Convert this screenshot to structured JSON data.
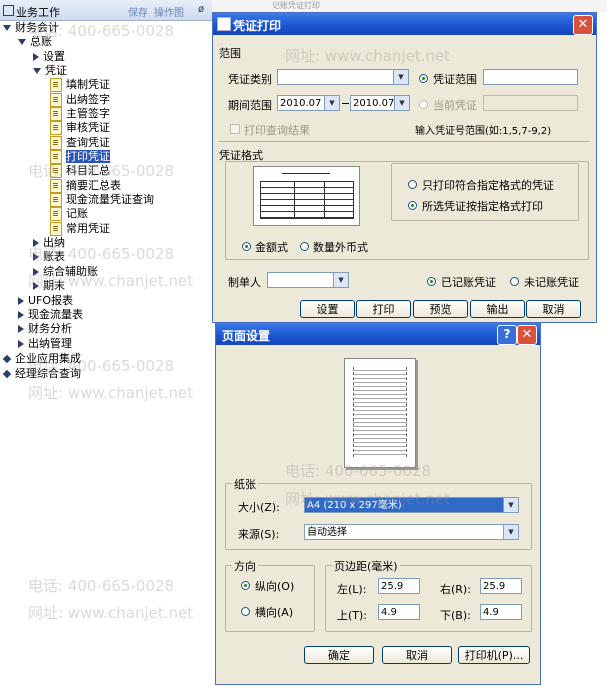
{
  "tree": {
    "header_title": "业务工作",
    "header_btn_save": "保存",
    "header_btn_layout": "操作图",
    "header_pin": "ø",
    "nodes": [
      {
        "label": "财务会计"
      },
      {
        "label": "总账"
      },
      {
        "label": "设置"
      },
      {
        "label": "凭证"
      },
      {
        "label": "填制凭证"
      },
      {
        "label": "出纳签字"
      },
      {
        "label": "主管签字"
      },
      {
        "label": "审核凭证"
      },
      {
        "label": "查询凭证"
      },
      {
        "label": "打印凭证"
      },
      {
        "label": "科目汇总"
      },
      {
        "label": "摘要汇总表"
      },
      {
        "label": "现金流量凭证查询"
      },
      {
        "label": "记账"
      },
      {
        "label": "常用凭证"
      },
      {
        "label": "出纳"
      },
      {
        "label": "账表"
      },
      {
        "label": "综合辅助账"
      },
      {
        "label": "期末"
      },
      {
        "label": "UFO报表"
      },
      {
        "label": "现金流量表"
      },
      {
        "label": "财务分析"
      },
      {
        "label": "出纳管理"
      },
      {
        "label": "企业应用集成"
      },
      {
        "label": "经理综合查询"
      }
    ]
  },
  "top_strip_text": "记账凭证打印",
  "print_dialog": {
    "title": "凭证打印",
    "range_group": "范围",
    "voucher_type_label": "凭证类别",
    "voucher_type_value": "",
    "voucher_range_label": "凭证范围",
    "voucher_range_value": "",
    "period_label": "期间范围",
    "period_from": "2010.07",
    "period_to": "2010.07",
    "current_voucher_label": "当前凭证",
    "print_query_result_label": "打印查询结果",
    "hint": "输入凭证号范围(如:1,5,7-9,2)",
    "format_group": "凭证格式",
    "only_print_label": "只打印符合指定格式的凭证",
    "all_print_label": "所选凭证按指定格式打印",
    "amount_label": "金额式",
    "foreign_label": "数量外币式",
    "maker_label": "制单人",
    "maker_value": "",
    "posted_label": "已记账凭证",
    "unposted_label": "未记账凭证",
    "buttons": [
      "设置",
      "打印",
      "预览",
      "输出",
      "取消"
    ]
  },
  "page_setup": {
    "title": "页面设置",
    "paper_group": "纸张",
    "size_label": "大小(Z):",
    "size_value": "A4 (210 x 297毫米)",
    "source_label": "来源(S):",
    "source_value": "自动选择",
    "orientation_group": "方向",
    "portrait_label": "纵向(O)",
    "landscape_label": "横向(A)",
    "margins_group": "页边距(毫米)",
    "left_label": "左(L):",
    "left_value": "25.9",
    "right_label": "右(R):",
    "right_value": "25.9",
    "top_label": "上(T):",
    "top_value": "4.9",
    "bottom_label": "下(B):",
    "bottom_value": "4.9",
    "ok_label": "确定",
    "cancel_label": "取消",
    "printer_label": "打印机(P)..."
  },
  "watermark": {
    "phone": "电话: 400-665-0028",
    "site": "网址: www.chanjet.net"
  },
  "colors": {
    "titlebar": "#1a55d0",
    "dialog_bg": "#ece9d8",
    "selection": "#2c56b3",
    "close_red": "#d9513b"
  }
}
